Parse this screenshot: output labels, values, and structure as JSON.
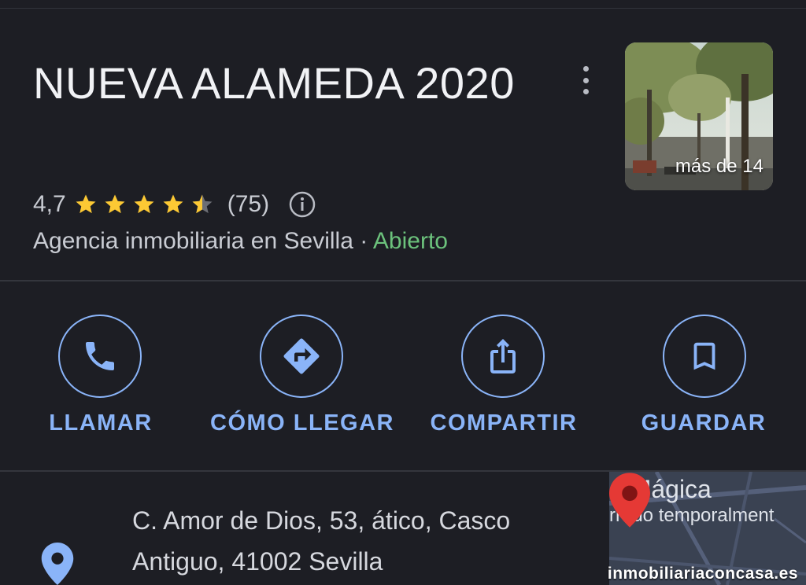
{
  "place": {
    "title": "NUEVA ALAMEDA 2020",
    "rating": "4,7",
    "rating_value": 4.7,
    "stars_max": 5,
    "review_count": "(75)",
    "category": "Agencia inmobiliaria en Sevilla",
    "separator": "·",
    "status": "Abierto",
    "photo_count": "más de 14"
  },
  "actions": [
    {
      "label": "LLAMAR",
      "icon": "phone-icon"
    },
    {
      "label": "CÓMO LLEGAR",
      "icon": "directions-icon"
    },
    {
      "label": "COMPARTIR",
      "icon": "share-icon"
    },
    {
      "label": "GUARDAR",
      "icon": "bookmark-icon"
    }
  ],
  "address": {
    "line1": "C. Amor de Dios, 53, ático, Casco",
    "line2": "Antiguo, 41002 Sevilla",
    "icon": "location-pin-icon"
  },
  "map": {
    "label1": "a Mágica",
    "label2": "rrado temporalment"
  },
  "watermark": "inmobiliariaconcasa.es",
  "colors": {
    "background": "#1d1e24",
    "accent": "#8ab4f8",
    "open": "#6cc27c",
    "star": "#fcc934",
    "pin": "#e53935"
  }
}
